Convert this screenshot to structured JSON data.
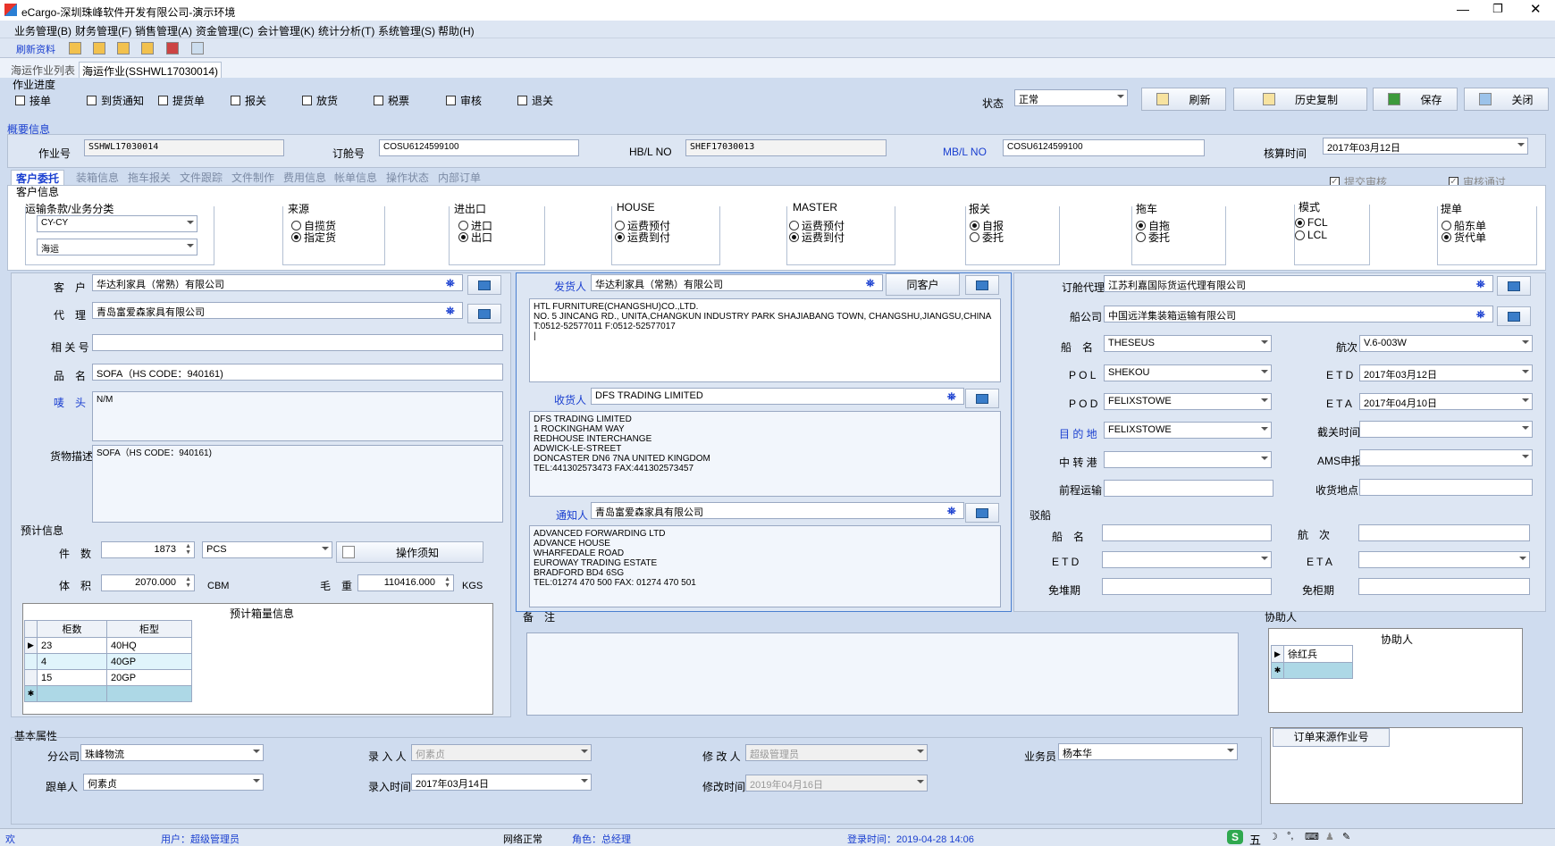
{
  "window": {
    "title": "eCargo-深圳珠峰软件开发有限公司-演示环境"
  },
  "menu": [
    "业务管理(B)",
    "财务管理(F)",
    "销售管理(A)",
    "资金管理(C)",
    "会计管理(K)",
    "统计分析(T)",
    "系统管理(S)",
    "帮助(H)"
  ],
  "toolbar": {
    "refresh_data": "刷新资料"
  },
  "doc_tabs": [
    "海运作业列表",
    "海运作业(SSHWL17030014)"
  ],
  "progress": {
    "title": "作业进度",
    "items": [
      {
        "label": "接单",
        "checked": false
      },
      {
        "label": "到货通知",
        "checked": false
      },
      {
        "label": "提货单",
        "checked": false
      },
      {
        "label": "报关",
        "checked": false
      },
      {
        "label": "放货",
        "checked": false
      },
      {
        "label": "税票",
        "checked": false
      },
      {
        "label": "审核",
        "checked": false
      },
      {
        "label": "退关",
        "checked": false
      }
    ]
  },
  "status": {
    "label": "状态",
    "value": "正常"
  },
  "actions": {
    "refresh": "刷新",
    "history_copy": "历史复制",
    "save": "保存",
    "close": "关闭"
  },
  "summary": {
    "title": "概要信息",
    "job_no_label": "作业号",
    "job_no": "SSHWL17030014",
    "booking_no_label": "订舱号",
    "booking_no": "COSU6124599100",
    "hbl_label": "HB/L NO",
    "hbl": "SHEF17030013",
    "mbl_label": "MB/L NO",
    "mbl": "COSU6124599100",
    "acct_time_label": "核算时间",
    "acct_time": "2017年03月12日"
  },
  "sub_tabs": [
    "客户委托",
    "装箱信息",
    "拖车报关",
    "文件跟踪",
    "文件制作",
    "费用信息",
    "帐单信息",
    "操作状态",
    "内部订单"
  ],
  "submit_audit": "提交审核",
  "audit_passed": "审核通过",
  "customer_info": {
    "title": "客户信息",
    "transport_label": "运输条款/业务分类",
    "transport_terms": "CY-CY",
    "business_type": "海运",
    "source": {
      "title": "来源",
      "options": [
        "自揽货",
        "指定货"
      ],
      "selected": 1
    },
    "io": {
      "title": "进出口",
      "options": [
        "进口",
        "出口"
      ],
      "selected": 1
    },
    "house": {
      "title": "HOUSE",
      "options": [
        "运费预付",
        "运费到付"
      ],
      "selected": 1
    },
    "master": {
      "title": "MASTER",
      "options": [
        "运费预付",
        "运费到付"
      ],
      "selected": 1
    },
    "customs": {
      "title": "报关",
      "options": [
        "自报",
        "委托"
      ],
      "selected": 0
    },
    "trucking": {
      "title": "拖车",
      "options": [
        "自拖",
        "委托"
      ],
      "selected": 0
    },
    "mode": {
      "title": "模式",
      "options": [
        "FCL",
        "LCL"
      ],
      "selected": 0
    },
    "bl": {
      "title": "提单",
      "options": [
        "船东单",
        "货代单"
      ],
      "selected": 1
    }
  },
  "left": {
    "customer_label": "客　户",
    "customer": "华达利家具（常熟）有限公司",
    "agent_label": "代　理",
    "agent": "青岛富爱森家具有限公司",
    "ref_label": "相 关 号",
    "ref": "",
    "product_label": "品　名",
    "product": "SOFA（HS CODE：940161)",
    "marks_label": "唛　头",
    "marks": "N/M",
    "goods_desc_label": "货物描述",
    "goods_desc": "SOFA（HS CODE：940161)",
    "est_title": "预计信息",
    "pieces_label": "件　数",
    "pieces": "1873",
    "pieces_unit": "PCS",
    "op_notice": "操作须知",
    "volume_label": "体　积",
    "volume": "2070.000",
    "volume_unit": "CBM",
    "weight_label": "毛　重",
    "weight": "110416.000",
    "weight_unit": "KGS",
    "container_title": "预计箱量信息",
    "container_headers": [
      "柜数",
      "柜型"
    ],
    "containers": [
      {
        "count": "23",
        "type": "40HQ"
      },
      {
        "count": "4",
        "type": "40GP"
      },
      {
        "count": "15",
        "type": "20GP"
      }
    ]
  },
  "middle": {
    "shipper_label": "发货人",
    "shipper": "华达利家具（常熟）有限公司",
    "same_customer": "同客户",
    "shipper_addr": "HTL FURNITURE(CHANGSHU)CO.,LTD.\nNO. 5 JINCANG RD., UNITA,CHANGKUN INDUSTRY PARK SHAJIABANG TOWN, CHANGSHU,JIANGSU,CHINA\nT:0512-52577011 F:0512-52577017\n|",
    "consignee_label": "收货人",
    "consignee": "DFS TRADING LIMITED",
    "consignee_addr": "DFS TRADING LIMITED\n1 ROCKINGHAM WAY\nREDHOUSE INTERCHANGE\nADWICK-LE-STREET\nDONCASTER DN6 7NA UNITED KINGDOM\nTEL:441302573473 FAX:441302573457",
    "notify_label": "通知人",
    "notify": "青岛富爱森家具有限公司",
    "notify_addr": "ADVANCED FORWARDING LTD\nADVANCE HOUSE\nWHARFEDALE ROAD\nEUROWAY TRADING ESTATE\nBRADFORD BD4 6SG\nTEL:01274 470 500 FAX: 01274 470 501",
    "remarks_label": "备　注"
  },
  "right": {
    "booking_agent_label": "订舱代理",
    "booking_agent": "江苏利嘉国际货运代理有限公司",
    "carrier_label": "船公司",
    "carrier": "中国远洋集装箱运输有限公司",
    "vessel_label": "船　名",
    "vessel": "THESEUS",
    "voyage_label": "航次",
    "voyage": "V.6-003W",
    "pol_label": "P O L",
    "pol": "SHEKOU",
    "etd_label": "E T D",
    "etd": "2017年03月12日",
    "pod_label": "P O D",
    "pod": "FELIXSTOWE",
    "eta_label": "E T A",
    "eta": "2017年04月10日",
    "dest_label": "目 的 地",
    "dest": "FELIXSTOWE",
    "cutoff_label": "截关时间",
    "transit_label": "中 转 港",
    "ams_label": "AMS申报",
    "pre_carriage_label": "前程运输",
    "receipt_place_label": "收货地点",
    "barge_title": "驳船",
    "barge_vessel_label": "船　名",
    "barge_voyage_label": "航　次",
    "barge_etd_label": "E T D",
    "barge_eta_label": "E T A",
    "free_storage_label": "免堆期",
    "free_container_label": "免柜期",
    "assist_title": "协助人",
    "assist_header": "协助人",
    "assist_rows": [
      "徐红兵"
    ]
  },
  "basic": {
    "title": "基本属性",
    "branch_label": "分公司",
    "branch": "珠峰物流",
    "entry_by_label": "录 入 人",
    "entry_by": "何素贞",
    "modified_by_label": "修 改 人",
    "modified_by": "超级管理员",
    "sales_label": "业务员",
    "sales": "杨本华",
    "follower_label": "跟单人",
    "follower": "何素贞",
    "entry_time_label": "录入时间",
    "entry_time": "2017年03月14日",
    "modified_time_label": "修改时间",
    "modified_time": "2019年04月16日",
    "order_source": "订单来源作业号"
  },
  "statusbar": {
    "welcome": "欢",
    "user": "用户：超级管理员",
    "network": "网络正常",
    "role": "角色：总经理",
    "login_time": "登录时间：2019-04-28 14:06",
    "ime": "五"
  }
}
